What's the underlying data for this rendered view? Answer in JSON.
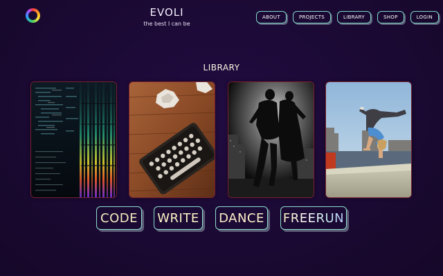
{
  "header": {
    "logo_icon": "color-ring-logo",
    "brand_title": "EVOLI",
    "brand_tagline": "the best I can be"
  },
  "nav": {
    "items": [
      {
        "label": "ABOUT"
      },
      {
        "label": "PROJECTS"
      },
      {
        "label": "LIBRARY"
      },
      {
        "label": "SHOP"
      },
      {
        "label": "LOGIN"
      }
    ]
  },
  "main": {
    "section_title": "LIBRARY",
    "cards": [
      {
        "image": "code-screen-image",
        "label": "CODE"
      },
      {
        "image": "typewriter-image",
        "label": "WRITE"
      },
      {
        "image": "dancers-image",
        "label": "DANCE"
      },
      {
        "image": "freerunner-image",
        "label": "FREERUN"
      }
    ]
  },
  "colors": {
    "background": "#1a0a33",
    "button_border": "#8fe0d0",
    "button_shadow": "#5d5d78",
    "card_border": "#7a2030"
  }
}
